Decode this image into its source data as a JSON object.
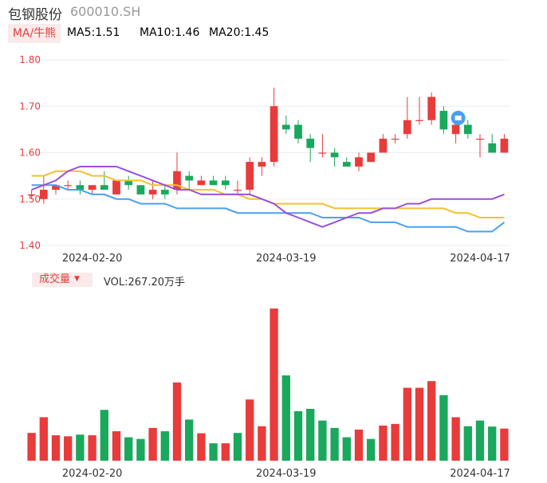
{
  "header": {
    "stock_name": "包钢股份",
    "stock_code": "600010.SH"
  },
  "ma_legend": {
    "tag_label": "MA/牛熊",
    "ma5": "MA5:1.51",
    "ma10": "MA10:1.46",
    "ma20": "MA20:1.45"
  },
  "volume_legend": {
    "tag_label": "成交量",
    "value": "VOL:267.20万手"
  },
  "colors": {
    "up": "#e83b3b",
    "down": "#1aa85c",
    "ma5": "#9b4fdb",
    "ma10": "#f2c12e",
    "ma20": "#4a9ff0",
    "tag_bg": "#fbeaea",
    "axis_text": "#e33f3f"
  },
  "icons": [
    "logo-badge-icon",
    "caret-down-icon"
  ],
  "chart_data": [
    {
      "type": "candlestick",
      "ylim": [
        1.4,
        1.8
      ],
      "y_ticks": [
        "1.80",
        "1.70",
        "1.60",
        "1.50",
        "1.40"
      ],
      "x_tick_labels": [
        {
          "label": "2024-02-20",
          "index": 5
        },
        {
          "label": "2024-03-19",
          "index": 21
        },
        {
          "label": "2024-04-17",
          "index": 37
        }
      ],
      "candles": [
        {
          "o": 1.51,
          "h": 1.52,
          "l": 1.5,
          "c": 1.51
        },
        {
          "o": 1.5,
          "h": 1.55,
          "l": 1.49,
          "c": 1.52
        },
        {
          "o": 1.52,
          "h": 1.53,
          "l": 1.51,
          "c": 1.53
        },
        {
          "o": 1.53,
          "h": 1.54,
          "l": 1.52,
          "c": 1.53
        },
        {
          "o": 1.53,
          "h": 1.54,
          "l": 1.51,
          "c": 1.52
        },
        {
          "o": 1.52,
          "h": 1.53,
          "l": 1.51,
          "c": 1.53
        },
        {
          "o": 1.53,
          "h": 1.56,
          "l": 1.52,
          "c": 1.52
        },
        {
          "o": 1.51,
          "h": 1.54,
          "l": 1.51,
          "c": 1.54
        },
        {
          "o": 1.54,
          "h": 1.55,
          "l": 1.52,
          "c": 1.53
        },
        {
          "o": 1.53,
          "h": 1.53,
          "l": 1.51,
          "c": 1.51
        },
        {
          "o": 1.51,
          "h": 1.54,
          "l": 1.5,
          "c": 1.52
        },
        {
          "o": 1.52,
          "h": 1.53,
          "l": 1.5,
          "c": 1.51
        },
        {
          "o": 1.52,
          "h": 1.6,
          "l": 1.51,
          "c": 1.56
        },
        {
          "o": 1.55,
          "h": 1.56,
          "l": 1.52,
          "c": 1.54
        },
        {
          "o": 1.53,
          "h": 1.55,
          "l": 1.53,
          "c": 1.54
        },
        {
          "o": 1.54,
          "h": 1.55,
          "l": 1.53,
          "c": 1.53
        },
        {
          "o": 1.54,
          "h": 1.55,
          "l": 1.52,
          "c": 1.53
        },
        {
          "o": 1.52,
          "h": 1.54,
          "l": 1.51,
          "c": 1.52
        },
        {
          "o": 1.52,
          "h": 1.59,
          "l": 1.51,
          "c": 1.58
        },
        {
          "o": 1.57,
          "h": 1.59,
          "l": 1.55,
          "c": 1.58
        },
        {
          "o": 1.58,
          "h": 1.74,
          "l": 1.57,
          "c": 1.7
        },
        {
          "o": 1.66,
          "h": 1.68,
          "l": 1.64,
          "c": 1.65
        },
        {
          "o": 1.66,
          "h": 1.67,
          "l": 1.62,
          "c": 1.63
        },
        {
          "o": 1.63,
          "h": 1.64,
          "l": 1.58,
          "c": 1.61
        },
        {
          "o": 1.6,
          "h": 1.64,
          "l": 1.59,
          "c": 1.6
        },
        {
          "o": 1.6,
          "h": 1.61,
          "l": 1.57,
          "c": 1.59
        },
        {
          "o": 1.58,
          "h": 1.59,
          "l": 1.57,
          "c": 1.57
        },
        {
          "o": 1.57,
          "h": 1.6,
          "l": 1.56,
          "c": 1.59
        },
        {
          "o": 1.58,
          "h": 1.6,
          "l": 1.58,
          "c": 1.6
        },
        {
          "o": 1.6,
          "h": 1.64,
          "l": 1.6,
          "c": 1.63
        },
        {
          "o": 1.63,
          "h": 1.64,
          "l": 1.62,
          "c": 1.63
        },
        {
          "o": 1.64,
          "h": 1.72,
          "l": 1.63,
          "c": 1.67
        },
        {
          "o": 1.67,
          "h": 1.72,
          "l": 1.66,
          "c": 1.67
        },
        {
          "o": 1.67,
          "h": 1.73,
          "l": 1.66,
          "c": 1.72
        },
        {
          "o": 1.69,
          "h": 1.7,
          "l": 1.64,
          "c": 1.65
        },
        {
          "o": 1.64,
          "h": 1.68,
          "l": 1.62,
          "c": 1.66
        },
        {
          "o": 1.66,
          "h": 1.67,
          "l": 1.63,
          "c": 1.64
        },
        {
          "o": 1.63,
          "h": 1.64,
          "l": 1.59,
          "c": 1.63
        },
        {
          "o": 1.62,
          "h": 1.64,
          "l": 1.6,
          "c": 1.6
        },
        {
          "o": 1.6,
          "h": 1.64,
          "l": 1.6,
          "c": 1.63
        }
      ],
      "ma5": [
        1.52,
        1.53,
        1.54,
        1.56,
        1.57,
        1.57,
        1.57,
        1.57,
        1.56,
        1.55,
        1.54,
        1.53,
        1.52,
        1.52,
        1.51,
        1.51,
        1.51,
        1.51,
        1.51,
        1.5,
        1.49,
        1.47,
        1.46,
        1.45,
        1.44,
        1.45,
        1.46,
        1.47,
        1.47,
        1.48,
        1.48,
        1.49,
        1.49,
        1.5,
        1.5,
        1.5,
        1.5,
        1.5,
        1.5,
        1.51
      ],
      "ma10": [
        1.55,
        1.55,
        1.56,
        1.56,
        1.56,
        1.55,
        1.55,
        1.54,
        1.54,
        1.54,
        1.53,
        1.53,
        1.53,
        1.52,
        1.52,
        1.52,
        1.51,
        1.51,
        1.5,
        1.5,
        1.49,
        1.49,
        1.49,
        1.49,
        1.49,
        1.48,
        1.48,
        1.48,
        1.48,
        1.48,
        1.48,
        1.48,
        1.48,
        1.48,
        1.48,
        1.47,
        1.47,
        1.46,
        1.46,
        1.46
      ],
      "ma20": [
        1.53,
        1.53,
        1.53,
        1.52,
        1.52,
        1.51,
        1.51,
        1.5,
        1.5,
        1.49,
        1.49,
        1.49,
        1.48,
        1.48,
        1.48,
        1.48,
        1.48,
        1.47,
        1.47,
        1.47,
        1.47,
        1.47,
        1.47,
        1.47,
        1.46,
        1.46,
        1.46,
        1.46,
        1.45,
        1.45,
        1.45,
        1.44,
        1.44,
        1.44,
        1.44,
        1.44,
        1.43,
        1.43,
        1.43,
        1.45
      ]
    },
    {
      "type": "bar",
      "series_name": "成交量",
      "x_tick_labels": [
        {
          "label": "2024-02-20",
          "index": 5
        },
        {
          "label": "2024-03-19",
          "index": 21
        },
        {
          "label": "2024-04-17",
          "index": 37
        }
      ],
      "values": [
        83,
        130,
        76,
        73,
        78,
        76,
        152,
        88,
        70,
        65,
        98,
        88,
        234,
        123,
        82,
        52,
        52,
        83,
        183,
        103,
        455,
        255,
        148,
        155,
        120,
        98,
        70,
        93,
        65,
        105,
        110,
        218,
        218,
        238,
        196,
        130,
        103,
        120,
        102,
        96
      ],
      "directions": [
        "up",
        "up",
        "up",
        "up",
        "down",
        "up",
        "down",
        "up",
        "down",
        "down",
        "up",
        "down",
        "up",
        "down",
        "up",
        "down",
        "up",
        "down",
        "up",
        "up",
        "up",
        "down",
        "down",
        "down",
        "down",
        "down",
        "down",
        "up",
        "down",
        "up",
        "up",
        "up",
        "up",
        "up",
        "down",
        "up",
        "down",
        "down",
        "down",
        "up"
      ],
      "ylim": [
        0,
        460
      ]
    }
  ]
}
